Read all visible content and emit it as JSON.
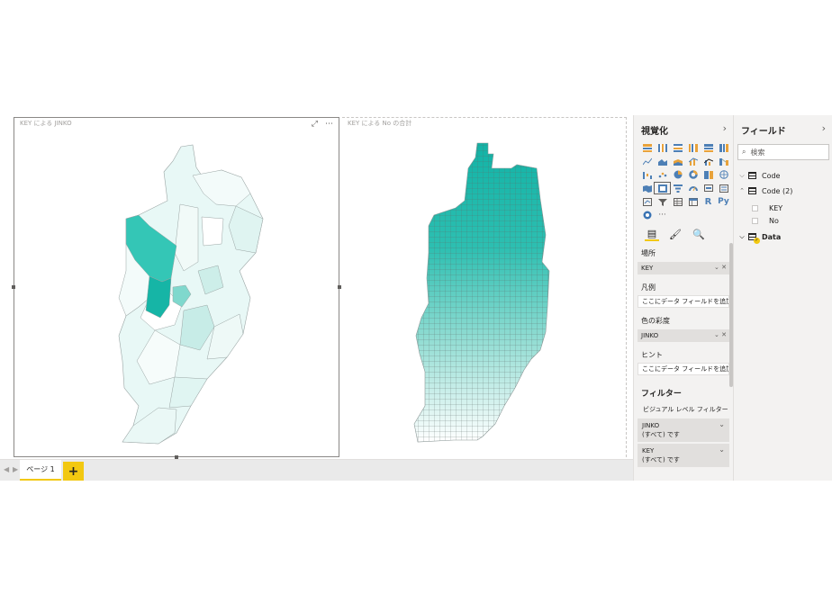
{
  "canvas": {
    "visual1_title": "KEY による JINKO",
    "visual2_title": "KEY による No の合計"
  },
  "pages": {
    "tab_label": "ページ 1",
    "add_label": "+"
  },
  "visualizations": {
    "title": "視覚化",
    "wells": {
      "location_label": "場所",
      "location_value": "KEY",
      "legend_label": "凡例",
      "legend_placeholder": "ここにデータ フィールドを追加して...",
      "saturation_label": "色の彩度",
      "saturation_value": "JINKO",
      "tooltips_label": "ヒント",
      "tooltips_placeholder": "ここにデータ フィールドを追加して..."
    },
    "filters": {
      "title": "フィルター",
      "subtitle": "ビジュアル レベル フィルター",
      "cards": [
        {
          "field": "JINKO",
          "state": "(すべて) です"
        },
        {
          "field": "KEY",
          "state": "(すべて) です"
        }
      ]
    },
    "gallery_text": {
      "r": "R",
      "py": "Py",
      "more": "···"
    }
  },
  "fields_pane": {
    "title": "フィールド",
    "search_placeholder": "検索",
    "tables": [
      {
        "name": "Code",
        "expanded": false
      },
      {
        "name": "Code (2)",
        "expanded": true,
        "fields": [
          "KEY",
          "No"
        ]
      },
      {
        "name": "Data",
        "expanded": false,
        "in_use": true
      }
    ]
  },
  "colors": {
    "accent": "#f2c811",
    "map_teal": "#12b3a6",
    "map_light": "#e8f8f6"
  }
}
